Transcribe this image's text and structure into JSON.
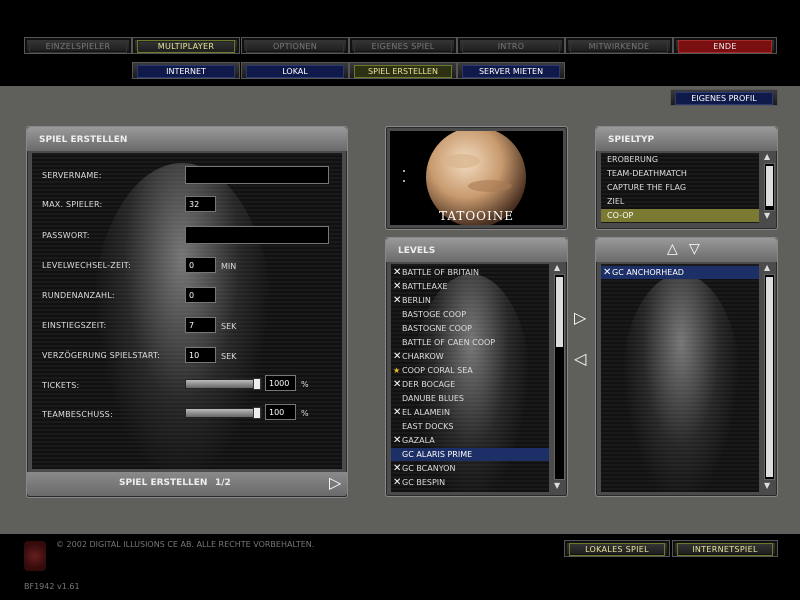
{
  "nav": {
    "top": [
      "EINZELSPIELER",
      "MULTIPLAYER",
      "OPTIONEN",
      "EIGENES SPIEL",
      "INTRO",
      "MITWIRKENDE",
      "ENDE"
    ],
    "sub": [
      "INTERNET",
      "LOKAL",
      "SPIEL ERSTELLEN",
      "SERVER MIETEN"
    ],
    "profile": "EIGENES PROFIL"
  },
  "form": {
    "title": "SPIEL ERSTELLEN",
    "labels": {
      "servername": "SERVERNAME:",
      "max_players": "MAX. SPIELER:",
      "password": "PASSWORT:",
      "level_change": "LEVELWECHSEL-ZEIT:",
      "rounds": "RUNDENANZAHL:",
      "spawn_time": "EINSTIEGSZEIT:",
      "start_delay": "VERZÖGERUNG SPIELSTART:",
      "tickets": "TICKETS:",
      "teamkill": "TEAMBESCHUSS:"
    },
    "values": {
      "servername": "",
      "max_players": "32",
      "password": "",
      "level_change": "0",
      "rounds": "0",
      "spawn_time": "7",
      "start_delay": "10",
      "tickets": "1000",
      "teamkill": "100"
    },
    "units": {
      "min": "MIN",
      "sek": "SEK",
      "pct": "%"
    },
    "sliders": {
      "tickets": 1.0,
      "teamkill": 1.0
    },
    "footer": "SPIEL ERSTELLEN",
    "page": "1/2"
  },
  "map": {
    "name": "TATOOINE"
  },
  "gametype": {
    "title": "SPIELTYP",
    "items": [
      "EROBERUNG",
      "TEAM-DEATHMATCH",
      "CAPTURE THE FLAG",
      "ZIEL",
      "CO-OP"
    ],
    "selected": "CO-OP"
  },
  "levels": {
    "title": "LEVELS",
    "items": [
      {
        "name": "BATTLE OF BRITAIN",
        "mark": "x"
      },
      {
        "name": "BATTLEAXE",
        "mark": "x"
      },
      {
        "name": "BERLIN",
        "mark": "x"
      },
      {
        "name": "BASTOGE COOP",
        "mark": ""
      },
      {
        "name": "BASTOGNE COOP",
        "mark": ""
      },
      {
        "name": "BATTLE OF CAEN COOP",
        "mark": ""
      },
      {
        "name": "CHARKOW",
        "mark": "x"
      },
      {
        "name": "COOP CORAL SEA",
        "mark": "star"
      },
      {
        "name": "DER BOCAGE",
        "mark": "x"
      },
      {
        "name": "DANUBE BLUES",
        "mark": ""
      },
      {
        "name": "EL ALAMEIN",
        "mark": "x"
      },
      {
        "name": "EAST DOCKS",
        "mark": ""
      },
      {
        "name": "GAZALA",
        "mark": "x"
      },
      {
        "name": "GC ALARIS PRIME",
        "mark": "",
        "selected": true
      },
      {
        "name": "GC BCANYON",
        "mark": "x"
      },
      {
        "name": "GC BESPIN",
        "mark": "x"
      }
    ]
  },
  "selected_levels": {
    "items": [
      {
        "name": "GC ANCHORHEAD",
        "mark": "x"
      }
    ]
  },
  "bottom": {
    "copyright": "© 2002 DIGITAL ILLUSIONS CE AB. ALLE RECHTE VORBEHALTEN.",
    "version": "BF1942 v1.61",
    "local_game": "LOKALES SPIEL",
    "internet_game": "INTERNETSPIEL"
  },
  "colors": {
    "accent_yellow": "#e8e49a",
    "end_red": "#7a0f12",
    "selection_blue": "#1c2f66",
    "highlight_olive": "#7a7a32"
  }
}
